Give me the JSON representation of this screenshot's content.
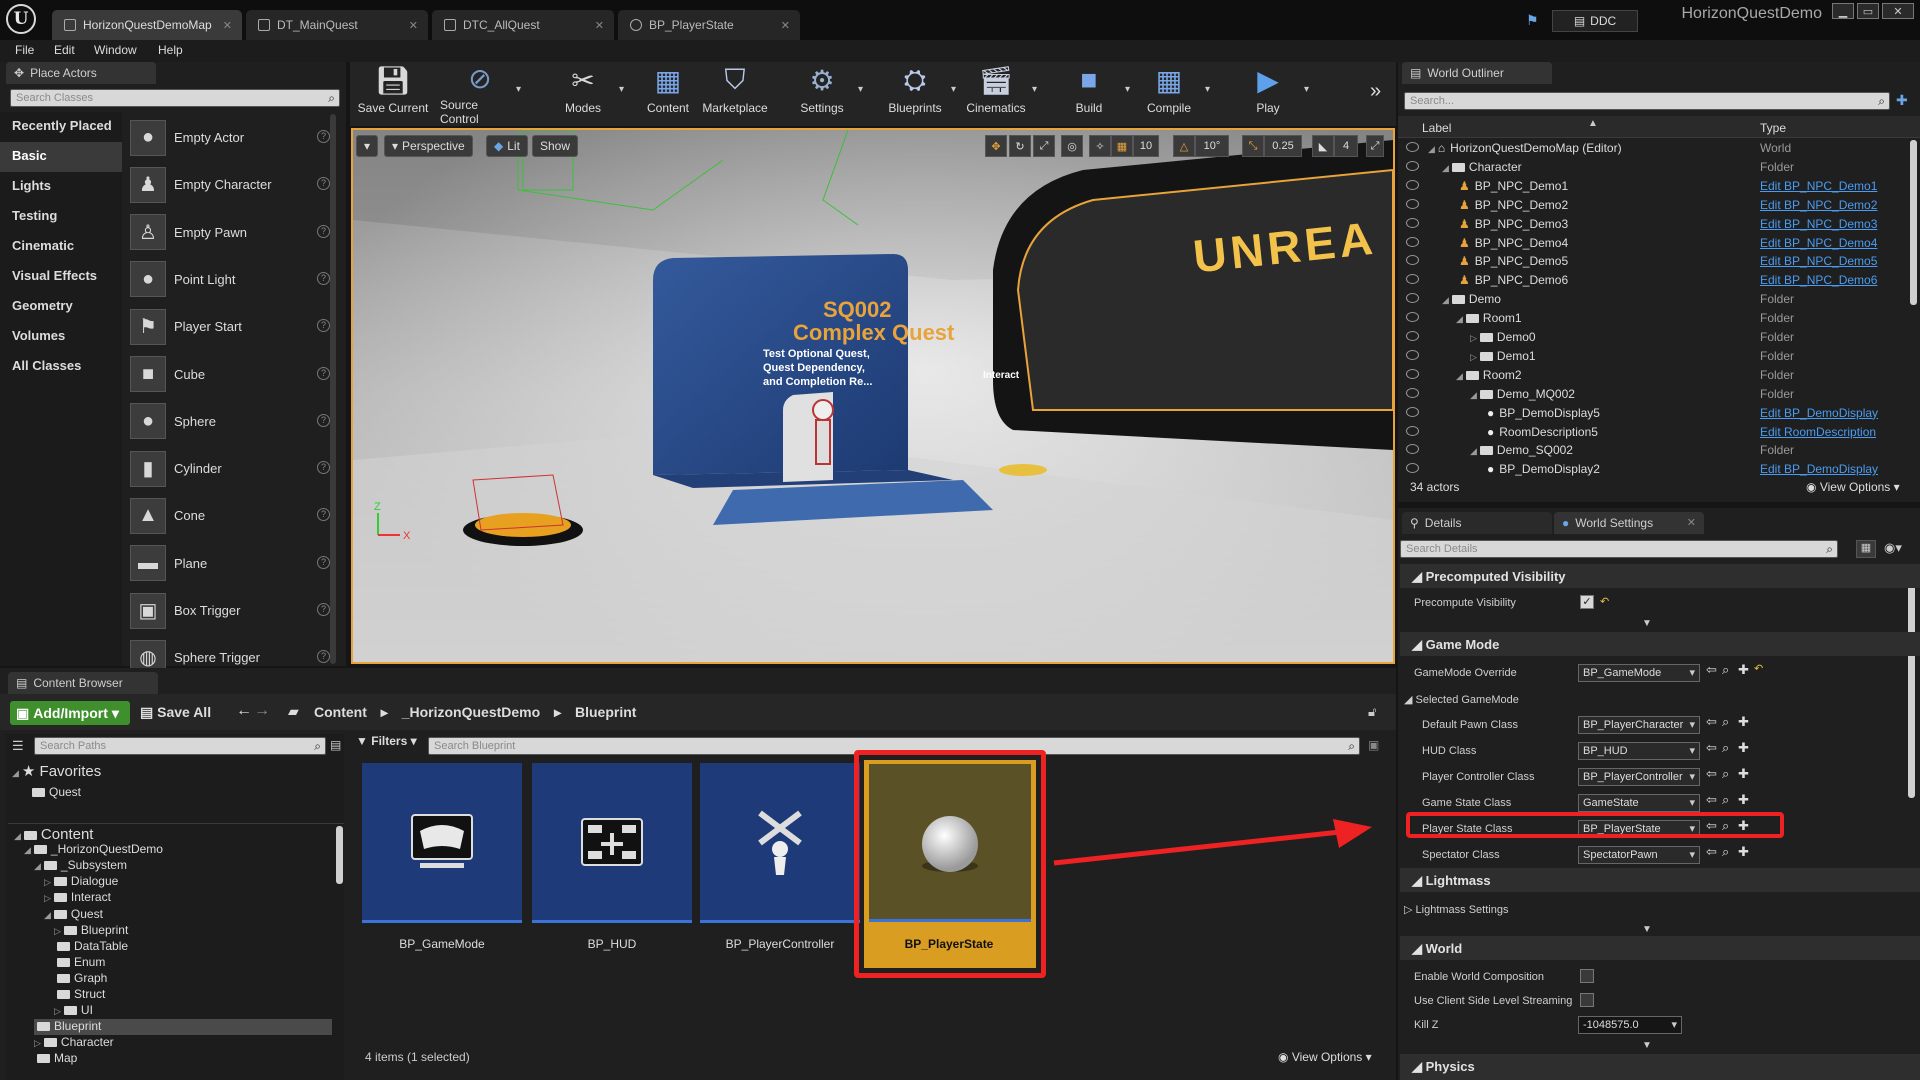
{
  "titlebar": {
    "tabs": [
      "HorizonQuestDemoMap",
      "DT_MainQuest",
      "DTC_AllQuest",
      "BP_PlayerState"
    ],
    "ddc_label": "DDC",
    "project_name": "HorizonQuestDemo"
  },
  "menubar": {
    "items": [
      "File",
      "Edit",
      "Window",
      "Help"
    ]
  },
  "place_actors": {
    "tab_label": "Place Actors",
    "search_placeholder": "Search Classes",
    "categories": [
      "Recently Placed",
      "Basic",
      "Lights",
      "Testing",
      "Cinematic",
      "Visual Effects",
      "Geometry",
      "Volumes",
      "All Classes"
    ],
    "selected_category": "Basic",
    "actors": [
      "Empty Actor",
      "Empty Character",
      "Empty Pawn",
      "Point Light",
      "Player Start",
      "Cube",
      "Sphere",
      "Cylinder",
      "Cone",
      "Plane",
      "Box Trigger",
      "Sphere Trigger"
    ]
  },
  "toolbar": {
    "buttons": [
      "Save Current",
      "Source Control",
      "Modes",
      "Content",
      "Marketplace",
      "Settings",
      "Blueprints",
      "Cinematics",
      "Build",
      "Compile",
      "Play"
    ],
    "more_icon": "chevron-double-right-icon"
  },
  "viewport": {
    "perspective_label": "Perspective",
    "lit_label": "Lit",
    "show_label": "Show",
    "grid_snap": "10",
    "rotation_snap": "10°",
    "scale_snap": "0.25",
    "camera_speed": "4",
    "scene_text": {
      "quest_id": "SQ002",
      "quest_title": "Complex Quest",
      "quest_desc": [
        "Test Optional Quest,",
        "Quest Dependency,",
        "and Completion Re..."
      ],
      "sign": "UNREA",
      "interact": "Interact"
    }
  },
  "world_outliner": {
    "tab_label": "World Outliner",
    "search_placeholder": "Search...",
    "col_label": "Label",
    "col_type": "Type",
    "rows": [
      {
        "label": "HorizonQuestDemoMap (Editor)",
        "type": "World",
        "indent": 0,
        "kind": "world",
        "link": false
      },
      {
        "label": "Character",
        "type": "Folder",
        "indent": 1,
        "kind": "folder",
        "link": false
      },
      {
        "label": "BP_NPC_Demo1",
        "type": "Edit BP_NPC_Demo1",
        "indent": 2,
        "kind": "npc",
        "link": true
      },
      {
        "label": "BP_NPC_Demo2",
        "type": "Edit BP_NPC_Demo2",
        "indent": 2,
        "kind": "npc",
        "link": true
      },
      {
        "label": "BP_NPC_Demo3",
        "type": "Edit BP_NPC_Demo3",
        "indent": 2,
        "kind": "npc",
        "link": true
      },
      {
        "label": "BP_NPC_Demo4",
        "type": "Edit BP_NPC_Demo4",
        "indent": 2,
        "kind": "npc",
        "link": true
      },
      {
        "label": "BP_NPC_Demo5",
        "type": "Edit BP_NPC_Demo5",
        "indent": 2,
        "kind": "npc",
        "link": true
      },
      {
        "label": "BP_NPC_Demo6",
        "type": "Edit BP_NPC_Demo6",
        "indent": 2,
        "kind": "npc",
        "link": true
      },
      {
        "label": "Demo",
        "type": "Folder",
        "indent": 1,
        "kind": "folder",
        "link": false
      },
      {
        "label": "Room1",
        "type": "Folder",
        "indent": 2,
        "kind": "folder",
        "link": false
      },
      {
        "label": "Demo0",
        "type": "Folder",
        "indent": 3,
        "kind": "folder",
        "link": false
      },
      {
        "label": "Demo1",
        "type": "Folder",
        "indent": 3,
        "kind": "folder",
        "link": false
      },
      {
        "label": "Room2",
        "type": "Folder",
        "indent": 2,
        "kind": "folder",
        "link": false
      },
      {
        "label": "Demo_MQ002",
        "type": "Folder",
        "indent": 3,
        "kind": "folder",
        "link": false
      },
      {
        "label": "BP_DemoDisplay5",
        "type": "Edit BP_DemoDisplay",
        "indent": 4,
        "kind": "actor",
        "link": true
      },
      {
        "label": "RoomDescription5",
        "type": "Edit RoomDescription",
        "indent": 4,
        "kind": "actor",
        "link": true
      },
      {
        "label": "Demo_SQ002",
        "type": "Folder",
        "indent": 3,
        "kind": "folder",
        "link": false
      },
      {
        "label": "BP_DemoDisplay2",
        "type": "Edit BP_DemoDisplay",
        "indent": 4,
        "kind": "actor",
        "link": true
      }
    ],
    "actor_count": "34 actors",
    "view_options": "View Options"
  },
  "details": {
    "tab_details": "Details",
    "tab_world_settings": "World Settings",
    "search_placeholder": "Search Details",
    "sections": {
      "precomputed_visibility": "Precomputed Visibility",
      "game_mode": "Game Mode",
      "lightmass": "Lightmass",
      "world": "World",
      "physics": "Physics"
    },
    "precompute_visibility_label": "Precompute Visibility",
    "gamemode_override_label": "GameMode Override",
    "gamemode_override_value": "BP_GameMode",
    "selected_gamemode_label": "Selected GameMode",
    "class_rows": [
      {
        "label": "Default Pawn Class",
        "value": "BP_PlayerCharacter"
      },
      {
        "label": "HUD Class",
        "value": "BP_HUD"
      },
      {
        "label": "Player Controller Class",
        "value": "BP_PlayerController"
      },
      {
        "label": "Game State Class",
        "value": "GameState"
      },
      {
        "label": "Player State Class",
        "value": "BP_PlayerState"
      },
      {
        "label": "Spectator Class",
        "value": "SpectatorPawn"
      }
    ],
    "lightmass_settings_label": "Lightmass Settings",
    "enable_world_composition_label": "Enable World Composition",
    "client_side_streaming_label": "Use Client Side Level Streaming",
    "kill_z_label": "Kill Z",
    "kill_z_value": "-1048575.0"
  },
  "content_browser": {
    "tab_label": "Content Browser",
    "add_import": "Add/Import",
    "save_all": "Save All",
    "breadcrumb": [
      "Content",
      "_HorizonQuestDemo",
      "Blueprint"
    ],
    "search_paths_placeholder": "Search Paths",
    "filters_label": "Filters",
    "search_placeholder": "Search Blueprint",
    "favorites_label": "Favorites",
    "favorites": [
      "Quest"
    ],
    "tree": [
      {
        "label": "Content",
        "indent": 0
      },
      {
        "label": "_HorizonQuestDemo",
        "indent": 1
      },
      {
        "label": "_Subsystem",
        "indent": 2
      },
      {
        "label": "Dialogue",
        "indent": 3
      },
      {
        "label": "Interact",
        "indent": 3
      },
      {
        "label": "Quest",
        "indent": 3
      },
      {
        "label": "Blueprint",
        "indent": 4
      },
      {
        "label": "DataTable",
        "indent": 4
      },
      {
        "label": "Enum",
        "indent": 4
      },
      {
        "label": "Graph",
        "indent": 4
      },
      {
        "label": "Struct",
        "indent": 4
      },
      {
        "label": "UI",
        "indent": 4
      },
      {
        "label": "Blueprint",
        "indent": 2
      },
      {
        "label": "Character",
        "indent": 2
      },
      {
        "label": "Map",
        "indent": 2
      }
    ],
    "assets": [
      "BP_GameMode",
      "BP_HUD",
      "BP_PlayerController",
      "BP_PlayerState"
    ],
    "status": "4 items (1 selected)",
    "view_options": "View Options"
  },
  "colors": {
    "accent_orange": "#e8a33a",
    "annotation_red": "#ee2222",
    "asset_blue": "#1e3a78",
    "link_blue": "#4a9cf2",
    "add_import_green": "#3f8f2c"
  }
}
